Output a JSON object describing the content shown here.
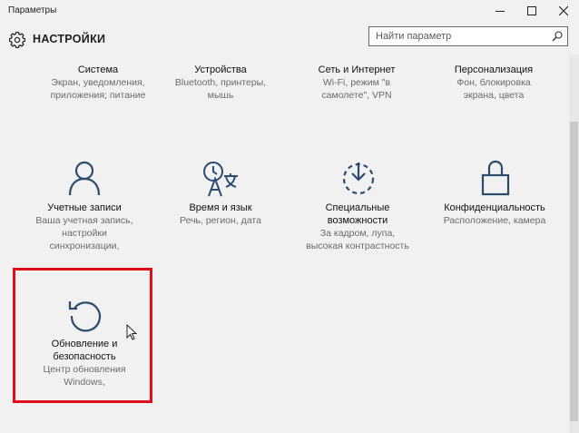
{
  "window": {
    "title": "Параметры"
  },
  "header": {
    "title": "НАСТРОЙКИ"
  },
  "search": {
    "placeholder": "Найти параметр"
  },
  "tiles_row1": [
    {
      "name": "Система",
      "desc1": "Экран, уведомления,",
      "desc2": "приложения; питание"
    },
    {
      "name": "Устройства",
      "desc1": "Bluetooth, принтеры,",
      "desc2": "мышь"
    },
    {
      "name": "Сеть и Интернет",
      "desc1": "Wi-Fi, режим \"в",
      "desc2": "самолете\", VPN"
    },
    {
      "name": "Персонализация",
      "desc1": "Фон, блокировка",
      "desc2": "экрана, цвета"
    }
  ],
  "tiles_row2": [
    {
      "name": "Учетные записи",
      "desc1": "Ваша учетная запись,",
      "desc2": "настройки",
      "desc3": "синхронизации,"
    },
    {
      "name": "Время и язык",
      "desc1": "Речь, регион, дата"
    },
    {
      "name1": "Специальные",
      "name2": "возможности",
      "desc1": "За кадром, лупа,",
      "desc2": "высокая контрастность"
    },
    {
      "name": "Конфиденциальность",
      "desc1": "Расположение, камера"
    }
  ],
  "tile_update": {
    "name1": "Обновление и",
    "name2": "безопасность",
    "desc1": "Центр обновления",
    "desc2": "Windows,"
  },
  "icons": [
    "gear-icon",
    "search-icon",
    "person-icon",
    "time-language-icon",
    "ease-of-access-icon",
    "lock-icon",
    "update-icon",
    "mouse-pointer-icon"
  ],
  "colors": {
    "accent": "#2b4c6f",
    "highlight": "#e10d18",
    "background": "#f1f1f1"
  }
}
